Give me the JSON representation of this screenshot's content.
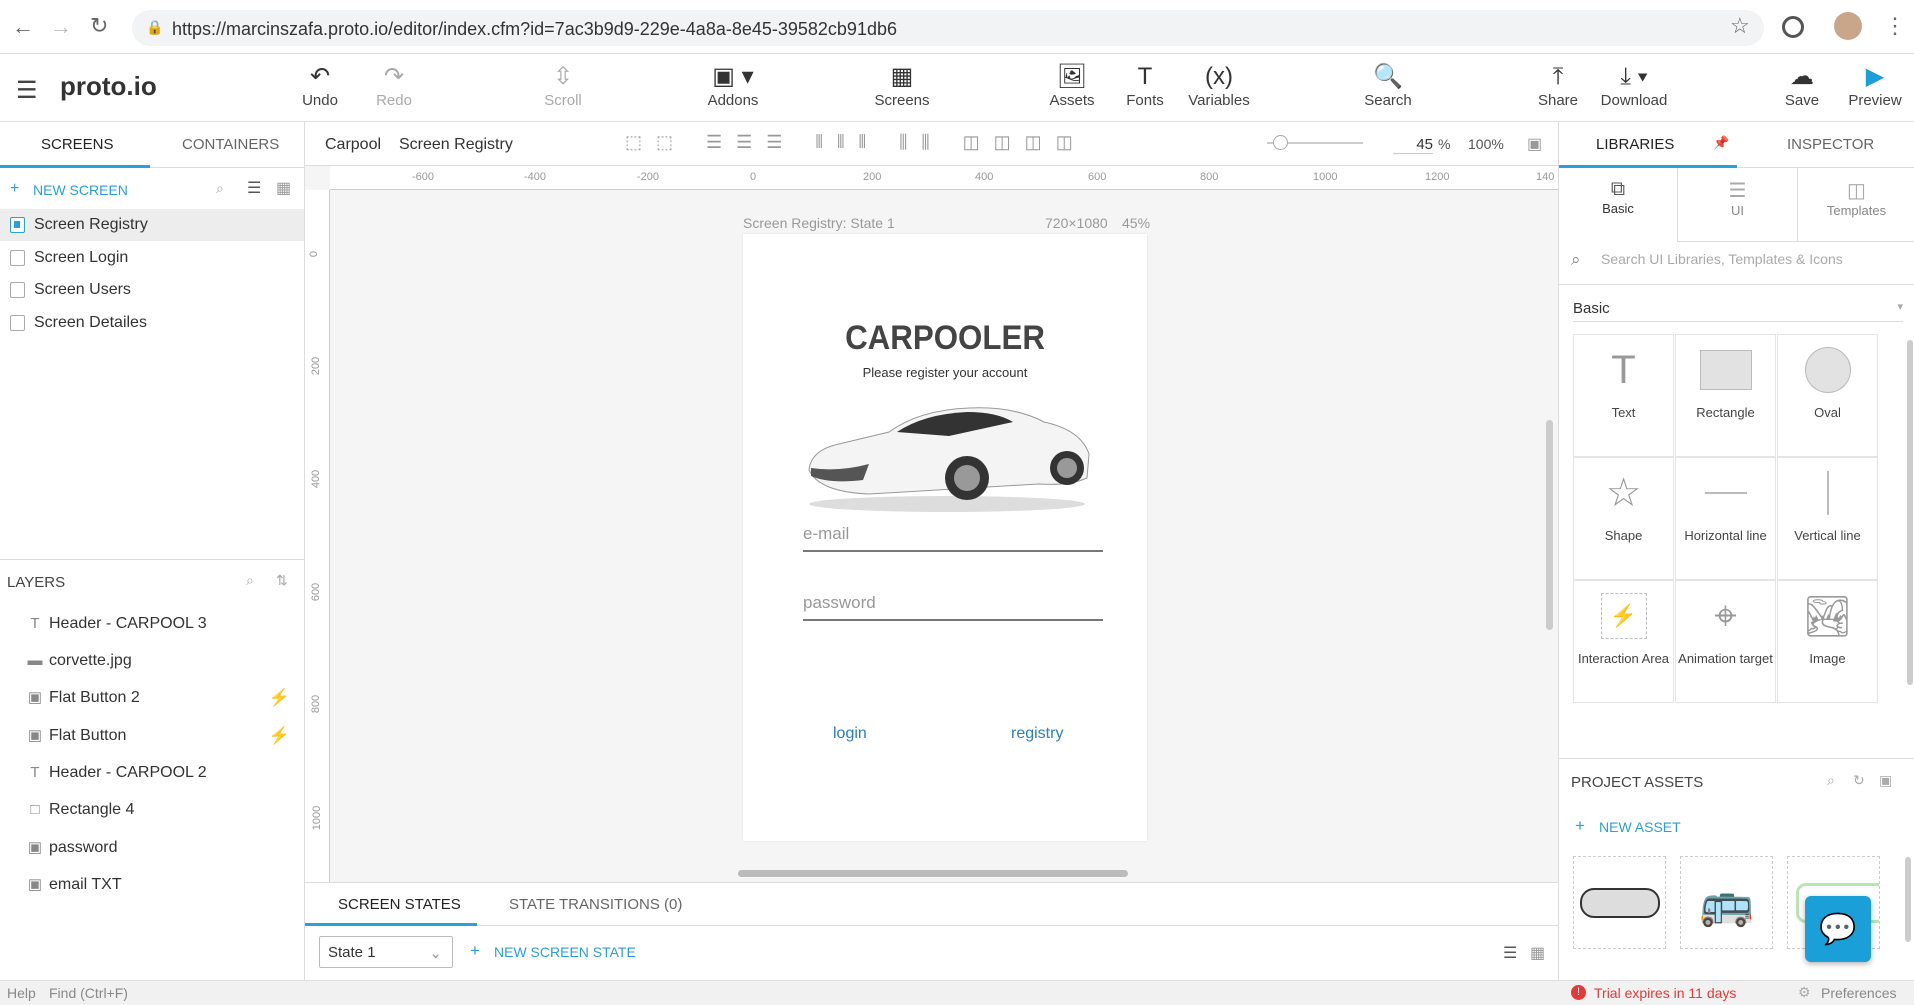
{
  "browser": {
    "url": "https://marcinszafa.proto.io/editor/index.cfm?id=7ac3b9d9-229e-4a8a-8e45-39582cb91db6"
  },
  "app": {
    "logo": "proto.io"
  },
  "toolbar": {
    "undo": "Undo",
    "redo": "Redo",
    "scroll": "Scroll",
    "addons": "Addons",
    "screens": "Screens",
    "assets": "Assets",
    "fonts": "Fonts",
    "variables": "Variables",
    "variables_icon": "(x)",
    "search": "Search",
    "share": "Share",
    "download": "Download",
    "save": "Save",
    "preview": "Preview"
  },
  "left": {
    "tabs": [
      "SCREENS",
      "CONTAINERS"
    ],
    "new_screen": "NEW SCREEN",
    "screens": [
      "Screen Registry",
      "Screen Login",
      "Screen Users",
      "Screen Detailes"
    ],
    "layers_title": "LAYERS",
    "layers": [
      "Header - CARPOOL 3",
      "corvette.jpg",
      "Flat Button 2",
      "Flat Button",
      "Header - CARPOOL 2",
      "Rectangle 4",
      "password",
      "email TXT"
    ]
  },
  "canvas": {
    "breadcrumb": [
      "Carpool",
      "Screen Registry"
    ],
    "zoom_value": "45",
    "zoom_unit": "%",
    "zoom_100": "100%",
    "ruler_h": [
      "-600",
      "-400",
      "-200",
      "0",
      "200",
      "400",
      "600",
      "800",
      "1000",
      "1200",
      "140"
    ],
    "ruler_v": [
      "0",
      "200",
      "400",
      "600",
      "800",
      "1000"
    ],
    "frame_label": "Screen Registry: State 1",
    "frame_size": "720×1080",
    "frame_zoom": "45%"
  },
  "phone": {
    "title": "CARPOOLER",
    "subtitle": "Please register your account",
    "email_placeholder": "e-mail",
    "password_placeholder": "password",
    "login": "login",
    "registry": "registry"
  },
  "states": {
    "tabs": [
      "SCREEN STATES",
      "STATE TRANSITIONS (0)"
    ],
    "selected": "State 1",
    "new_state": "NEW SCREEN STATE"
  },
  "right": {
    "tabs": [
      "LIBRARIES",
      "INSPECTOR"
    ],
    "lib_tabs": [
      "Basic",
      "UI",
      "Templates"
    ],
    "search_placeholder": "Search UI Libraries, Templates & Icons",
    "category": "Basic",
    "items": [
      "Text",
      "Rectangle",
      "Oval",
      "Shape",
      "Horizontal line",
      "Vertical line",
      "Interaction Area",
      "Animation target",
      "Image"
    ],
    "assets_title": "PROJECT ASSETS",
    "new_asset": "NEW ASSET"
  },
  "status": {
    "help": "Help",
    "find": "Find (Ctrl+F)",
    "trial": "Trial expires in 11 days",
    "preferences": "Preferences"
  },
  "colors": {
    "accent": "#29a0d8",
    "preview": "#1a9fd8",
    "trial": "#e53935"
  }
}
